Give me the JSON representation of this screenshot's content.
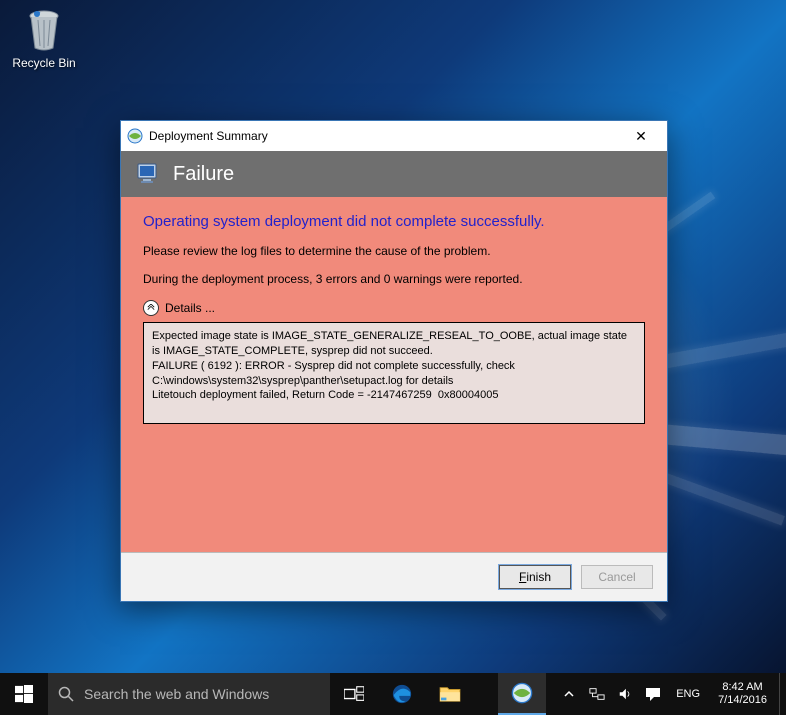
{
  "desktop": {
    "recycle_bin_label": "Recycle Bin"
  },
  "dialog": {
    "title": "Deployment Summary",
    "header": "Failure",
    "headline": "Operating system deployment did not complete successfully.",
    "review_line": "Please review the log files to determine the cause of the problem.",
    "stats_line": "During the deployment process, 3 errors and 0 warnings were reported.",
    "details_label": "Details ...",
    "details_text": "Expected image state is IMAGE_STATE_GENERALIZE_RESEAL_TO_OOBE, actual image state is IMAGE_STATE_COMPLETE, sysprep did not succeed.\nFAILURE ( 6192 ): ERROR - Sysprep did not complete successfully, check C:\\windows\\system32\\sysprep\\panther\\setupact.log for details\nLitetouch deployment failed, Return Code = -2147467259  0x80004005",
    "finish_label": "Finish",
    "cancel_label": "Cancel"
  },
  "taskbar": {
    "search_placeholder": "Search the web and Windows",
    "language": "ENG",
    "clock_time": "8:42 AM",
    "clock_date": "7/14/2016"
  }
}
